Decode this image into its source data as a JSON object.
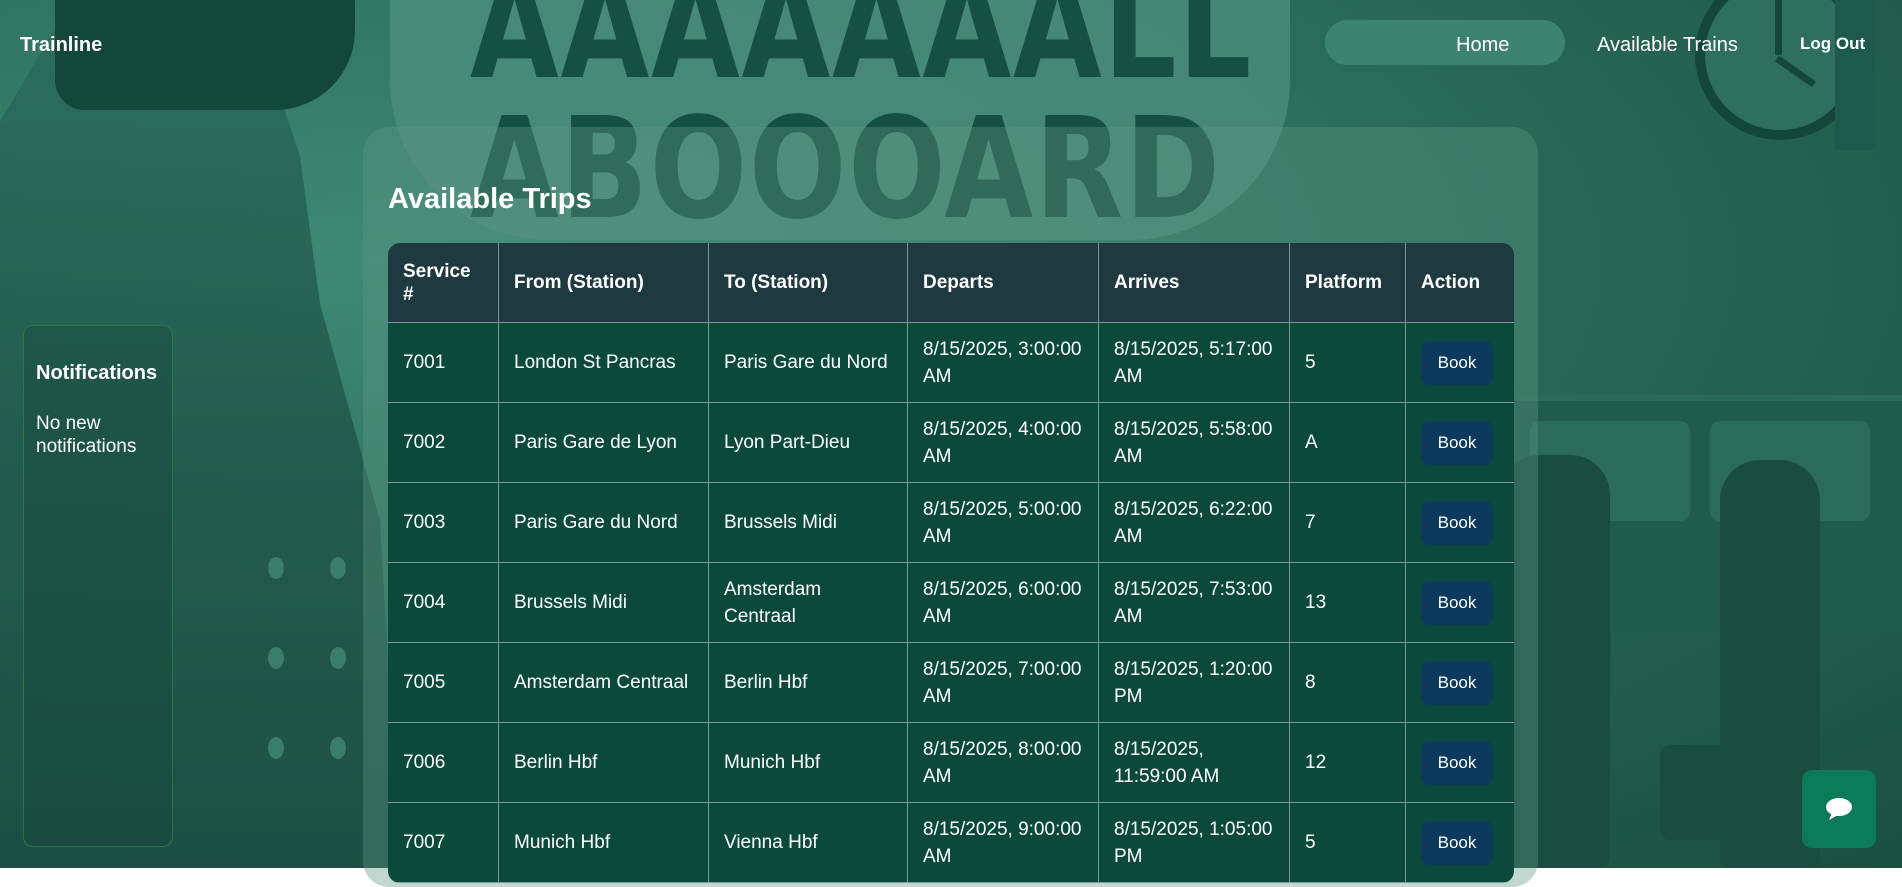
{
  "nav": {
    "brand": "Trainline",
    "home": "Home",
    "available_trains": "Available Trains",
    "logout": "Log Out"
  },
  "background": {
    "headline_line1": "AAAAAAALL",
    "headline_line2": "ABOOOARD"
  },
  "notifications": {
    "title": "Notifications",
    "message": "No new notifications"
  },
  "main": {
    "title": "Available Trips",
    "table": {
      "headers": [
        "Service #",
        "From (Station)",
        "To (Station)",
        "Departs",
        "Arrives",
        "Platform",
        "Action"
      ],
      "rows": [
        {
          "service": "7001",
          "from": "London St Pancras",
          "to": "Paris Gare du Nord",
          "departs": "8/15/2025, 3:00:00 AM",
          "arrives": "8/15/2025, 5:17:00 AM",
          "platform": "5",
          "action": "Book"
        },
        {
          "service": "7002",
          "from": "Paris Gare de Lyon",
          "to": "Lyon Part-Dieu",
          "departs": "8/15/2025, 4:00:00 AM",
          "arrives": "8/15/2025, 5:58:00 AM",
          "platform": "A",
          "action": "Book"
        },
        {
          "service": "7003",
          "from": "Paris Gare du Nord",
          "to": "Brussels Midi",
          "departs": "8/15/2025, 5:00:00 AM",
          "arrives": "8/15/2025, 6:22:00 AM",
          "platform": "7",
          "action": "Book"
        },
        {
          "service": "7004",
          "from": "Brussels Midi",
          "to": "Amsterdam Centraal",
          "departs": "8/15/2025, 6:00:00 AM",
          "arrives": "8/15/2025, 7:53:00 AM",
          "platform": "13",
          "action": "Book"
        },
        {
          "service": "7005",
          "from": "Amsterdam Centraal",
          "to": "Berlin Hbf",
          "departs": "8/15/2025, 7:00:00 AM",
          "arrives": "8/15/2025, 1:20:00 PM",
          "platform": "8",
          "action": "Book"
        },
        {
          "service": "7006",
          "from": "Berlin Hbf",
          "to": "Munich Hbf",
          "departs": "8/15/2025, 8:00:00 AM",
          "arrives": "8/15/2025, 11:59:00 AM",
          "platform": "12",
          "action": "Book"
        },
        {
          "service": "7007",
          "from": "Munich Hbf",
          "to": "Vienna Hbf",
          "departs": "8/15/2025, 9:00:00 AM",
          "arrives": "8/15/2025, 1:05:00 PM",
          "platform": "5",
          "action": "Book"
        }
      ]
    }
  },
  "chat": {
    "icon": "chat-bubble-icon"
  },
  "colors": {
    "header_bg": "#1e3a40",
    "row_bg": "#0b4a3a",
    "book_button": "#0d3a5c",
    "chat_button": "#0b7a58"
  }
}
